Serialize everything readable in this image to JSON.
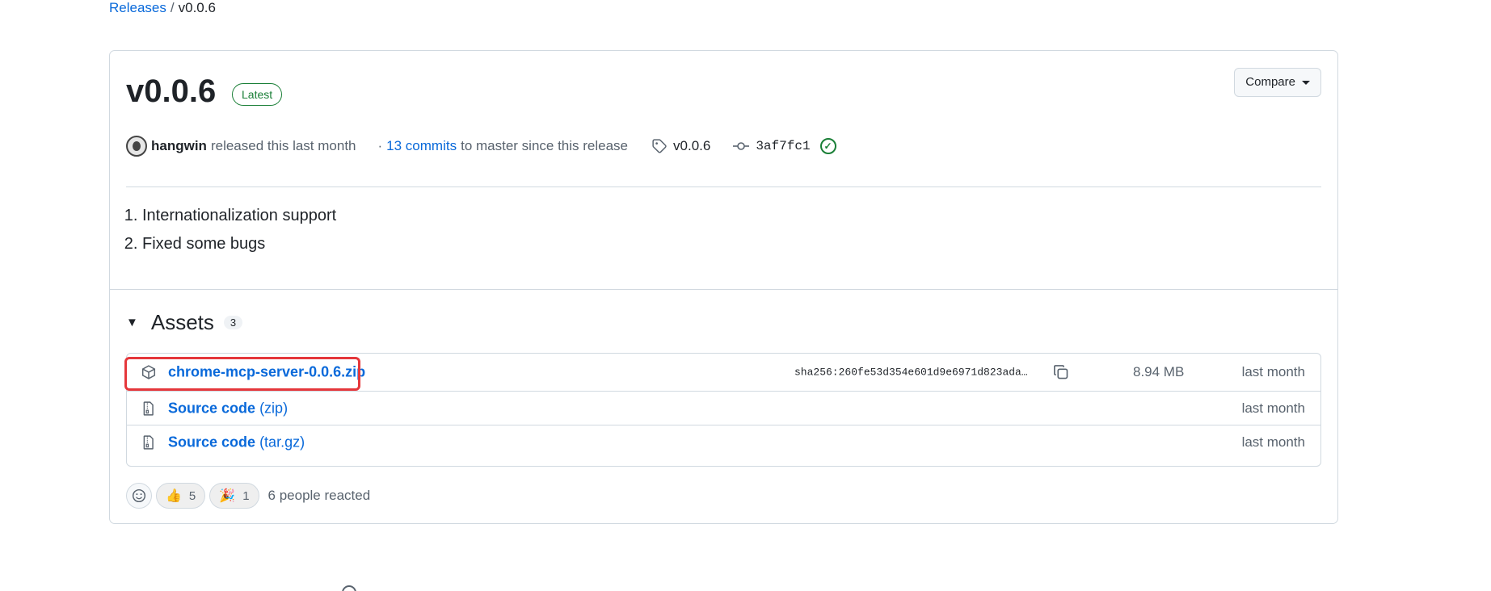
{
  "breadcrumb": {
    "parent": "Releases",
    "separator": "/",
    "current": "v0.0.6"
  },
  "release": {
    "title": "v0.0.6",
    "badge": "Latest",
    "compare_label": "Compare",
    "author": "hangwin",
    "released_text": "released this last month",
    "commits_prefix": "·",
    "commits_link": "13 commits",
    "commits_suffix": "to master since this release",
    "tag": "v0.0.6",
    "commit_sha": "3af7fc1",
    "notes": [
      "Internationalization support",
      "Fixed some bugs"
    ]
  },
  "assets": {
    "title": "Assets",
    "count": "3",
    "items": [
      {
        "name": "chrome-mcp-server-0.0.6.zip",
        "sha256": "sha256:260fe53d354e601d9e6971d823ada…",
        "size": "8.94 MB",
        "date": "last month",
        "icon": "package-icon"
      },
      {
        "name": "Source code",
        "ext": "(zip)",
        "date": "last month",
        "icon": "file-zip-icon"
      },
      {
        "name": "Source code",
        "ext": "(tar.gz)",
        "date": "last month",
        "icon": "file-zip-icon"
      }
    ]
  },
  "reactions": {
    "items": [
      {
        "emoji": "👍",
        "count": "5"
      },
      {
        "emoji": "🎉",
        "count": "1"
      }
    ],
    "summary": "6 people reacted"
  },
  "colors": {
    "link": "#0969da",
    "success": "#1a7f37",
    "highlight": "#e5373b",
    "border": "#d1d9e0"
  }
}
